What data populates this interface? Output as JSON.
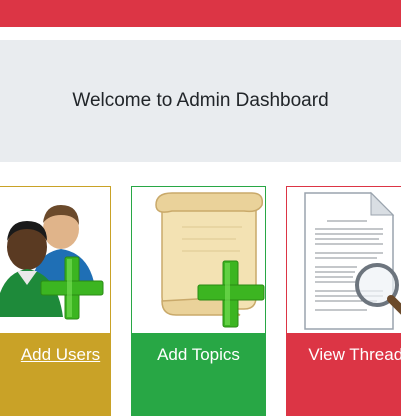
{
  "header": {
    "welcome_title": "Welcome to Admin Dashboard"
  },
  "cards": [
    {
      "label": "Add Users",
      "icon": "users-add-icon",
      "color": "#c9a227"
    },
    {
      "label": "Add Topics",
      "icon": "scroll-add-icon",
      "color": "#28a745"
    },
    {
      "label": "View Threads",
      "icon": "document-magnifier-icon",
      "color": "#dc3545"
    }
  ],
  "colors": {
    "topbar": "#dc3545",
    "jumbotron_bg": "#e9ecef"
  }
}
